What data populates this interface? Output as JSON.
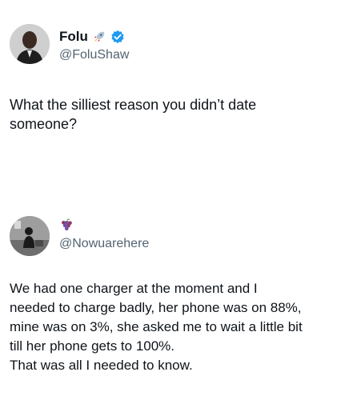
{
  "post_1": {
    "display_name": "Folu",
    "emoji_icon": "rocket-icon",
    "verified_icon": "verified-badge-icon",
    "handle": "@FoluShaw",
    "text": "What the silliest reason you didn’t date\nsomeone?"
  },
  "post_2": {
    "emoji_icon": "grapes-icon",
    "handle": "@Nowuarehere",
    "text": "We had one charger at the moment and I\nneeded to charge badly, her phone was on 88%,\nmine was on 3%, she asked me to wait a little bit\ntill her phone gets to 100%.\nThat was all I needed to know."
  },
  "colors": {
    "text": "#0f1419",
    "secondary": "#536471",
    "verified": "#1d9bf0"
  }
}
